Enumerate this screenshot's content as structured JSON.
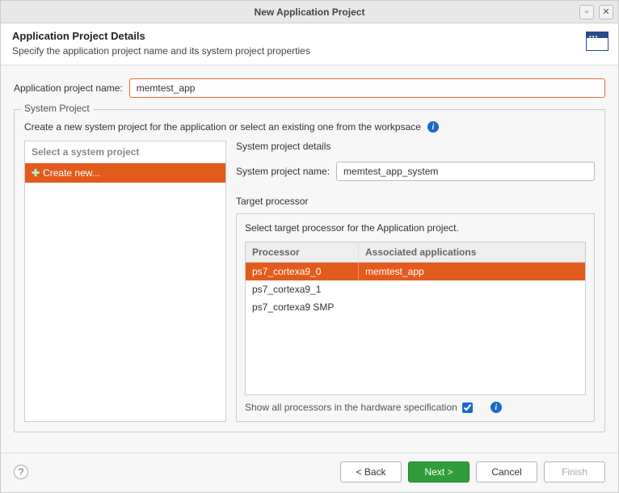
{
  "window": {
    "title": "New Application Project"
  },
  "banner": {
    "heading": "Application Project Details",
    "subtext": "Specify the application project name and its system project properties"
  },
  "form": {
    "app_name_label": "Application project name:",
    "app_name_value": "memtest_app"
  },
  "system_group": {
    "legend": "System Project",
    "description": "Create a new system project for the application or select an existing one from the workpsace",
    "list_header": "Select a system project",
    "items": [
      {
        "label": "Create new...",
        "selected": true
      }
    ],
    "details_title": "System project details",
    "sys_name_label": "System project name:",
    "sys_name_value": "memtest_app_system",
    "target_heading": "Target processor",
    "target_desc": "Select target processor for the Application project.",
    "table": {
      "columns": [
        "Processor",
        "Associated applications"
      ],
      "rows": [
        {
          "processor": "ps7_cortexa9_0",
          "app": "memtest_app",
          "selected": true
        },
        {
          "processor": "ps7_cortexa9_1",
          "app": "",
          "selected": false
        },
        {
          "processor": "ps7_cortexa9 SMP",
          "app": "",
          "selected": false
        }
      ]
    },
    "showall_label": "Show all processors in the hardware specification",
    "showall_checked": true
  },
  "buttons": {
    "back": "< Back",
    "next": "Next >",
    "cancel": "Cancel",
    "finish": "Finish"
  }
}
